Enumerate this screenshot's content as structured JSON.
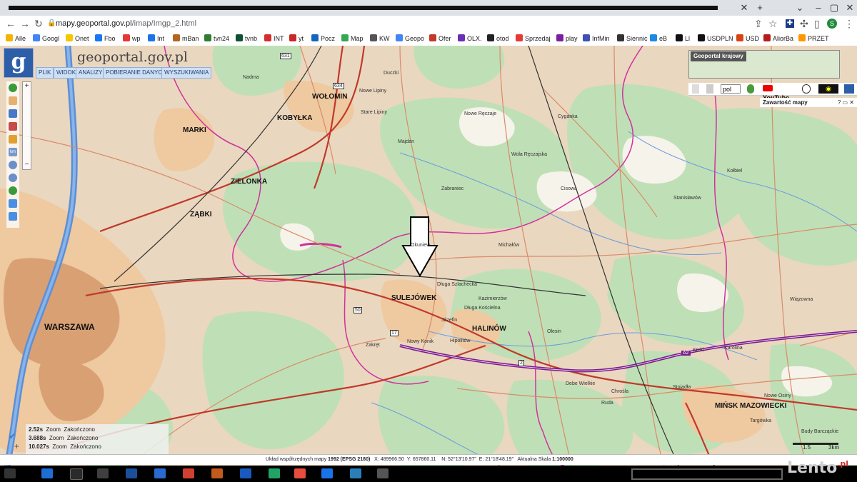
{
  "browser": {
    "url_host": "mapy.geoportal.gov.pl",
    "url_path": "/imap/Imgp_2.html",
    "bookmarks": [
      "Alle",
      "Googl",
      "Onet",
      "Fbo",
      "wp",
      "Int",
      "mBan",
      "tvn24",
      "tvnb",
      "INT",
      "yt",
      "Pocz",
      "Map",
      "KW",
      "Geopo",
      "Ofer",
      "OLX.",
      "otod",
      "Sprzedaj",
      "play",
      "InfMin",
      "Siennic",
      "eB",
      "Ll",
      "USDPLN",
      "USD",
      "AliorBa",
      "PRZET"
    ]
  },
  "portal": {
    "logo_letter": "g",
    "brand": "geoportal.gov.pl",
    "menu": [
      "PLIK",
      "WIDOK",
      "ANALIZY",
      "POBIERANIE DANYCH",
      "WYSZUKIWANIA"
    ],
    "minimap_title": "Geoportal krajowy",
    "language": "pol",
    "youtube_label": "YouTube",
    "legend_header": "Zawartość mapy"
  },
  "map": {
    "places_major": [
      {
        "name": "WARSZAWA",
        "size": "big"
      },
      {
        "name": "WOŁOMIN",
        "size": "normal"
      },
      {
        "name": "KOBYŁKA",
        "size": "normal"
      },
      {
        "name": "MARKI",
        "size": "normal"
      },
      {
        "name": "ZIELONKA",
        "size": "normal"
      },
      {
        "name": "ZĄBKI",
        "size": "normal"
      },
      {
        "name": "SULEJÓWEK",
        "size": "normal"
      },
      {
        "name": "HALINÓW",
        "size": "normal"
      },
      {
        "name": "MIŃSK MAZOWIECKI",
        "size": "normal"
      }
    ],
    "places_minor": [
      "Nadma",
      "Duczki",
      "Stare Lipiny",
      "Nowe Lipiny",
      "Majdan",
      "Nowe Ręczaje",
      "Wola Ręczajska",
      "Zabraniec",
      "Cisowa",
      "Michałów",
      "Długa Szlachecka",
      "Kazimierzów",
      "Długa Kościelna",
      "Okuniew",
      "Hipolitów",
      "Józefin",
      "Nowy Konik",
      "Zakręt",
      "Olesin",
      "Stanisławów",
      "Cyganka",
      "Kruki",
      "Stojadła",
      "Karolina",
      "Kołbiel",
      "Targówka",
      "Budy Barcząckie",
      "Nowe Osiny",
      "Chrośla",
      "Ruda",
      "Debe Wielkie",
      "Wiązowna"
    ],
    "road_labels": [
      "A2",
      "50",
      "17",
      "2",
      "631",
      "634"
    ]
  },
  "status": {
    "system_label": "Układ współrzędnych mapy",
    "system": "1992 (EPSG 2180)",
    "x": "X: 489966.50",
    "y": "Y: 657860.11",
    "n": "N: 52°13'10.97\"",
    "e": "E: 21°18'48.19\"",
    "scale_label": "Aktualna Skala",
    "scale": "1:100000"
  },
  "load_log": [
    {
      "time": "2.52s",
      "action": "Zoom",
      "result": "Zakończono"
    },
    {
      "time": "3.688s",
      "action": "Zoom",
      "result": "Zakończono"
    },
    {
      "time": "10.027s",
      "action": "Zoom",
      "result": "Zakończono"
    }
  ],
  "scalebar": {
    "left": "1.5",
    "right": "3km"
  },
  "watermark": {
    "brand": "Lento",
    "suffix": ".pl"
  },
  "colors": {
    "forest": "#bfe0b6",
    "urban": "#efc9a0",
    "road_main": "#c0392b",
    "motorway": "#7a1b8c",
    "water": "#5b8fd6",
    "boundary": "#d0329c"
  }
}
